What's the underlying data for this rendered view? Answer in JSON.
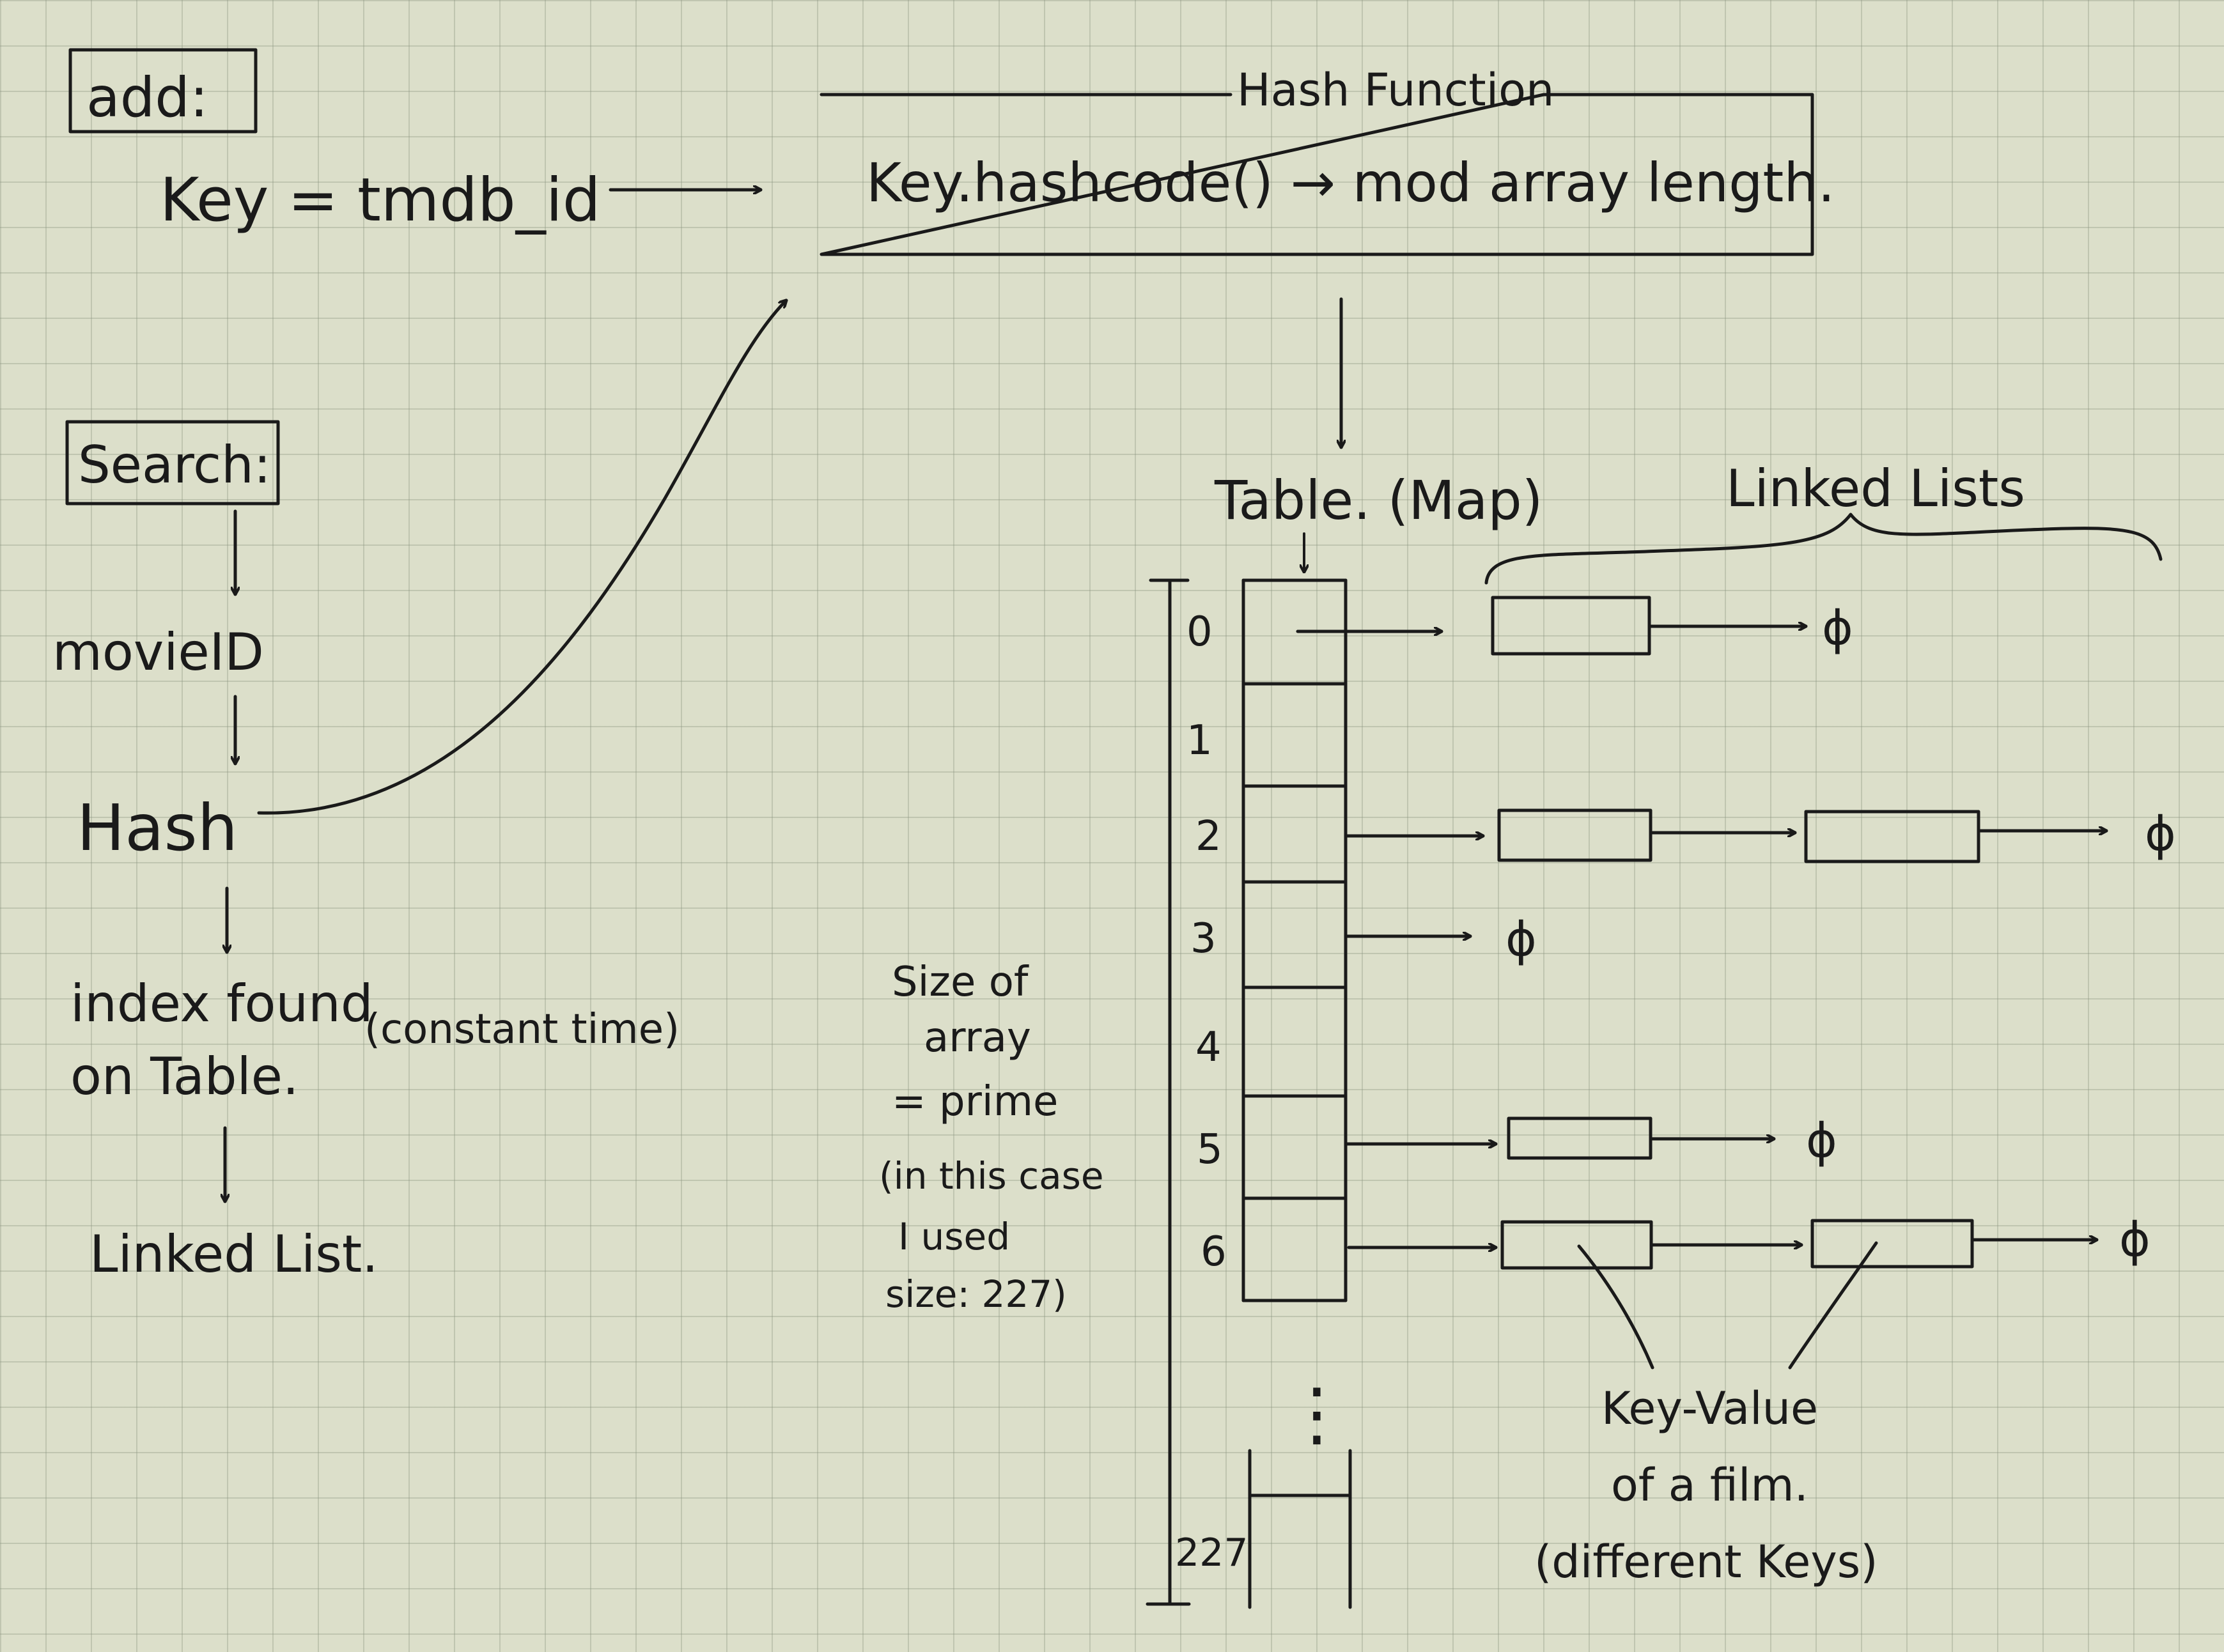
{
  "add": {
    "label": "add:",
    "key_expression": "Key = tmdb_id"
  },
  "hash_function": {
    "title": "Hash Function",
    "body": "Key.hashcode() → mod array length."
  },
  "search": {
    "label": "Search:",
    "steps": [
      "movieID",
      "Hash",
      "index found",
      "on Table.",
      "Linked List."
    ],
    "note": "(constant time)"
  },
  "table": {
    "label": "Table. (Map)",
    "indices": [
      "0",
      "1",
      "2",
      "3",
      "4",
      "5",
      "6",
      "227"
    ],
    "ellipsis": "⋮"
  },
  "linked_lists_label": "Linked Lists",
  "null_symbol": "ϕ",
  "size_note": {
    "lines": [
      "Size of",
      "array",
      "= prime",
      "(in this case",
      "I used",
      "size: 227)"
    ]
  },
  "key_value_note": {
    "lines": [
      "Key-Value",
      "of a film.",
      "(different Keys)"
    ]
  }
}
